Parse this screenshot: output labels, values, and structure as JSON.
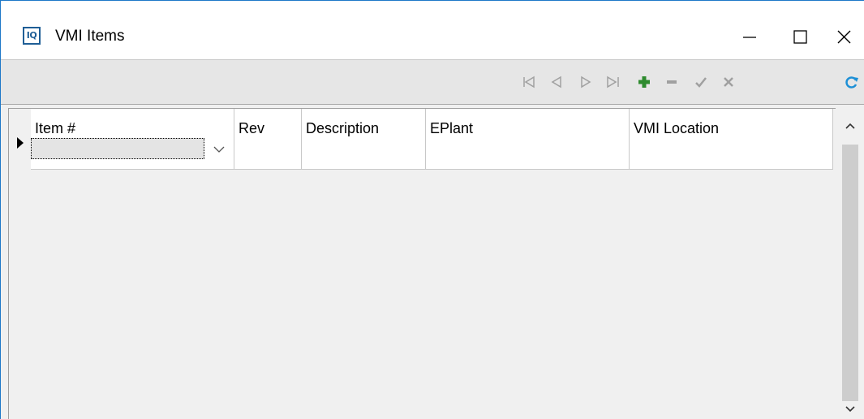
{
  "window": {
    "title": "VMI Items",
    "app_icon_text": "IQ"
  },
  "toolbar": {
    "buttons": [
      "first-record",
      "prior-record",
      "next-record",
      "last-record",
      "insert-record",
      "delete-record",
      "post-edit",
      "cancel-edit",
      "refresh-data"
    ]
  },
  "grid": {
    "columns": [
      "Item #",
      "Rev",
      "Description",
      "EPlant",
      "VMI Location"
    ],
    "rows": [
      {
        "item_no": "",
        "rev": "",
        "description": "",
        "eplant": "",
        "vmi_location": ""
      }
    ]
  },
  "colors": {
    "accent": "#1e78c8",
    "insert_icon": "#2e8b2e",
    "refresh_icon": "#1e90d6",
    "disabled_icon": "#a0a0a0"
  }
}
